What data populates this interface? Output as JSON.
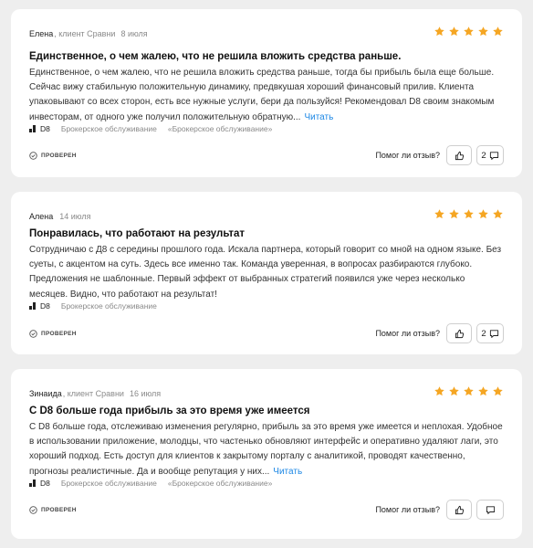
{
  "reviews": [
    {
      "author": "Елена",
      "sub": ", клиент Сравни",
      "date": "8 июля",
      "rating": 5,
      "title": "Единственное, о чем жалею, что не решила вложить средства раньше.",
      "text": "Единственное, о чем жалею, что не решила вложить средства раньше, тогда бы прибыль была еще больше. Сейчас вижу стабильную положительную динамику, предвкушая хороший финансовый прилив. Клиента упаковывают со всех сторон, есть все нужные услуги, бери да пользуйся! Рекомендовал D8 своим знакомым инвесторам, от одного уже получил положительную обратную...",
      "more": "Читать",
      "brand": "D8",
      "tags": [
        "Брокерское обслуживание",
        "«Брокерское обслуживание»"
      ],
      "verified": "ПРОВЕРЕН",
      "helpful": "Помог ли отзыв?",
      "comments": "2"
    },
    {
      "author": "Алена",
      "sub": "",
      "date": "14 июля",
      "rating": 5,
      "title": "Понравилась, что работают на результат",
      "text": "Сотрудничаю с Д8 с середины прошлого года. Искала партнера, который говорит со мной на одном языке. Без суеты, с акцентом на суть. Здесь все именно так. Команда уверенная, в вопросах разбираются глубоко. Предложения не шаблонные. Первый эффект от выбранных стратегий появился уже через несколько месяцев. Видно, что работают на результат!",
      "more": "",
      "brand": "D8",
      "tags": [
        "Брокерское обслуживание"
      ],
      "verified": "ПРОВЕРЕН",
      "helpful": "Помог ли отзыв?",
      "comments": "2"
    },
    {
      "author": "Зинаида",
      "sub": ", клиент Сравни",
      "date": "16 июля",
      "rating": 5,
      "title": "С D8 больше года прибыль за это время уже имеется",
      "text": "С D8 больше года, отслеживаю изменения регулярно, прибыль за это время уже имеется и неплохая. Удобное в использовании приложение, молодцы, что частенько обновляют интерфейс и оперативно удаляют лаги, это хороший подход. Есть доступ для клиентов к закрытому порталу с аналитикой, проводят качественно, прогнозы реалистичные. Да и вообще репутация у них...",
      "more": "Читать",
      "brand": "D8",
      "tags": [
        "Брокерское обслуживание",
        "«Брокерское обслуживание»"
      ],
      "verified": "ПРОВЕРЕН",
      "helpful": "Помог ли отзыв?",
      "comments": ""
    }
  ],
  "colors": {
    "star": "#f5a623",
    "link": "#1e88e5",
    "card": "#ffffff",
    "page": "#eeeeee"
  },
  "icons": {
    "star": "star-icon",
    "like": "thumbs-up-icon",
    "comment": "comment-icon",
    "verified": "shield-check-icon",
    "brand": "d8-logo-icon"
  }
}
